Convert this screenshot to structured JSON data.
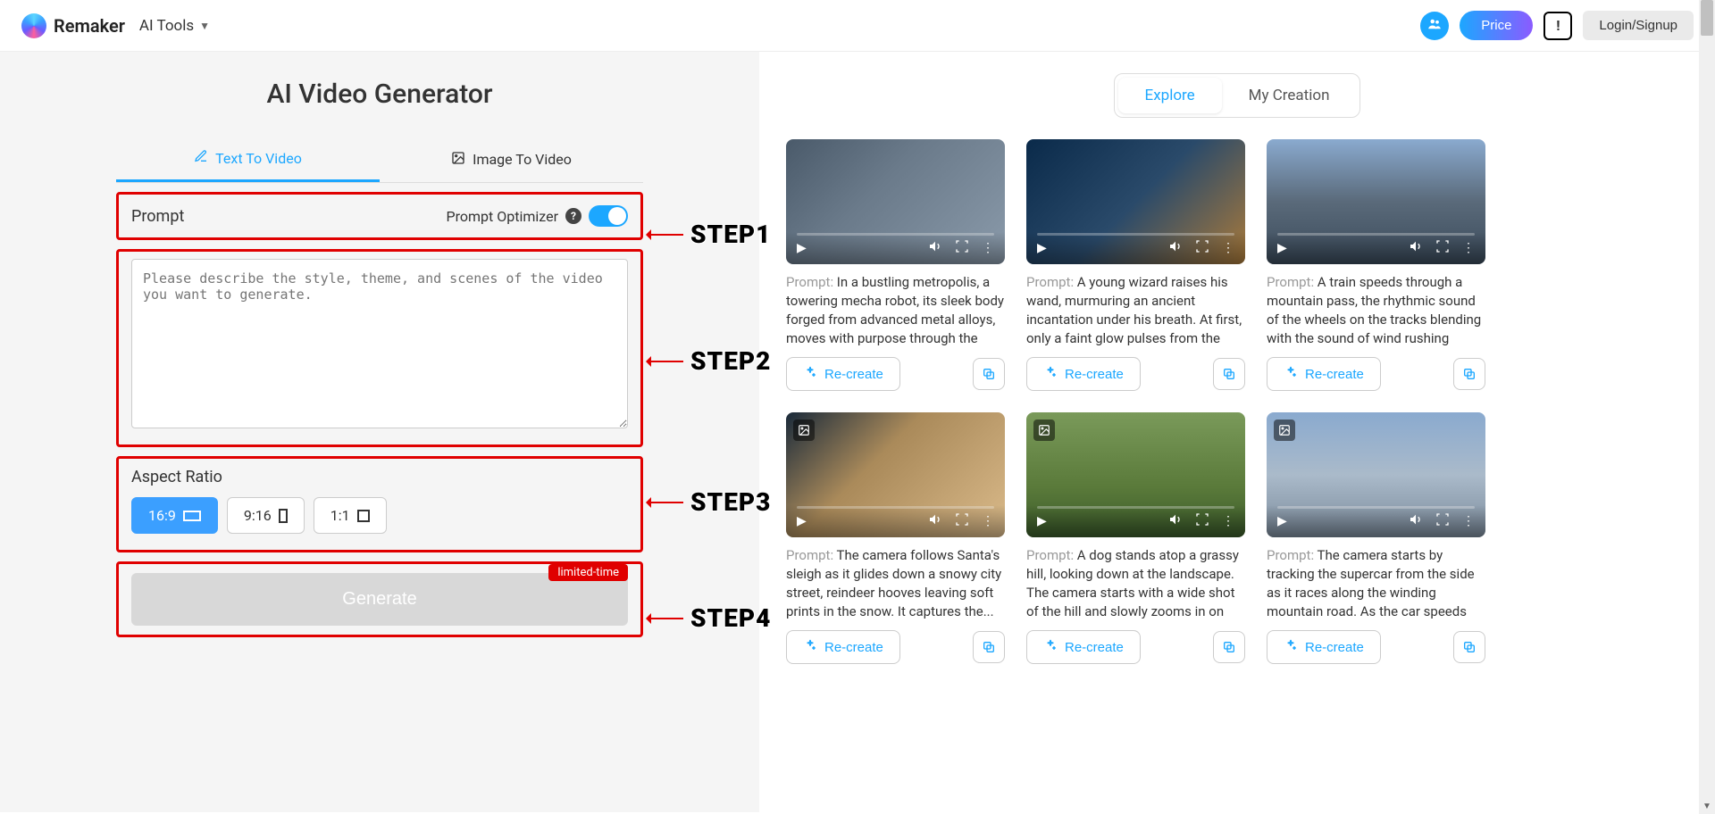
{
  "header": {
    "brand": "Remaker",
    "ai_tools_label": "AI Tools",
    "price_label": "Price",
    "login_label": "Login/Signup"
  },
  "left": {
    "title": "AI Video Generator",
    "tabs": {
      "text": "Text To Video",
      "image": "Image To Video"
    },
    "prompt_label": "Prompt",
    "optimizer_label": "Prompt Optimizer",
    "textarea_placeholder": "Please describe the style, theme, and scenes of the video you want to generate.",
    "aspect_label": "Aspect Ratio",
    "ratios": {
      "r1": "16:9",
      "r2": "9:16",
      "r3": "1:1"
    },
    "generate_label": "Generate",
    "limited_label": "limited-time"
  },
  "steps": {
    "s1": "STEP1",
    "s2": "STEP2",
    "s3": "STEP3",
    "s4": "STEP4"
  },
  "right": {
    "explore_label": "Explore",
    "creation_label": "My Creation",
    "recreate_label": "Re-create",
    "prompt_prefix": "Prompt: ",
    "cards": [
      {
        "prompt": "In a bustling metropolis, a towering mecha robot, its sleek body forged from advanced metal alloys, moves with purpose through the bus..."
      },
      {
        "prompt": "A young wizard raises his wand, murmuring an ancient incantation under his breath. At first, only a faint glow pulses from the tip..."
      },
      {
        "prompt": "A train speeds through a mountain pass, the rhythmic sound of the wheels on the tracks blending with the sound of wind rushing past..."
      },
      {
        "prompt": "The camera follows Santa's sleigh as it glides down a snowy city street, reindeer hooves leaving soft prints in the snow. It captures the..."
      },
      {
        "prompt": "A dog stands atop a grassy hill, looking down at the landscape. The camera starts with a wide shot of the hill and slowly zooms in on the..."
      },
      {
        "prompt": "The camera starts by tracking the supercar from the side as it races along the winding mountain road. As the car speeds up, the..."
      }
    ]
  }
}
